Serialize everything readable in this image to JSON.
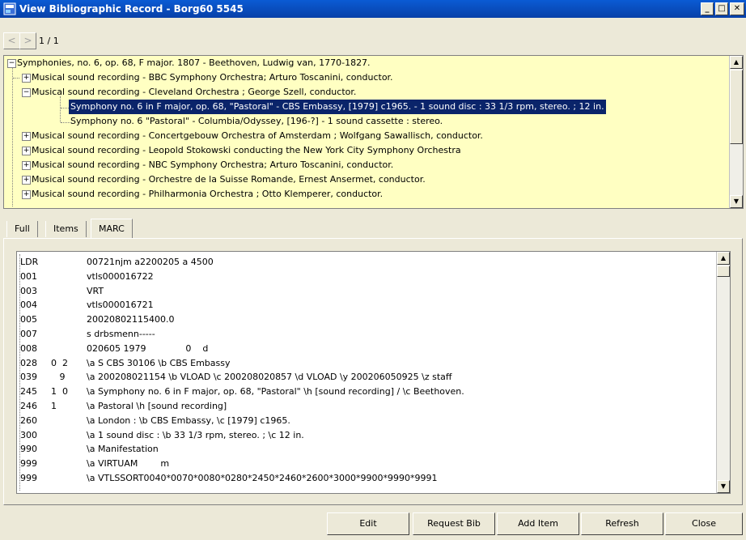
{
  "window": {
    "title": "View Bibliographic Record - Borg60 5545",
    "controls": [
      "_",
      "□",
      "✕"
    ]
  },
  "nav": {
    "prev": "<",
    "next": ">",
    "page": "1 / 1"
  },
  "tree": {
    "root": "Symphonies, no. 6, op. 68, F major. 1807 - Beethoven, Ludwig van, 1770-1827.",
    "items": [
      "Musical sound recording - BBC Symphony Orchestra; Arturo Toscanini, conductor.",
      "Musical sound recording - Cleveland Orchestra ; George Szell, conductor.",
      "Symphony no. 6 in F major, op. 68, \"Pastoral\" - CBS Embassy, [1979] c1965. - 1 sound disc : 33 1/3 rpm, stereo. ; 12 in.",
      "Symphony no. 6 \"Pastoral\" - Columbia/Odyssey, [196-?] - 1 sound cassette : stereo.",
      "Musical sound recording - Concertgebouw Orchestra of Amsterdam ; Wolfgang Sawallisch, conductor.",
      "Musical sound recording - Leopold Stokowski conducting the New York City Symphony Orchestra",
      "Musical sound recording - NBC Symphony Orchestra; Arturo Toscanini, conductor.",
      "Musical sound recording - Orchestre de la Suisse Romande, Ernest Ansermet, conductor.",
      "Musical sound recording - Philharmonia Orchestra ; Otto Klemperer, conductor."
    ]
  },
  "tabs": [
    "Full",
    "Items",
    "MARC"
  ],
  "marc": [
    {
      "tag": "LDR",
      "ind": "",
      "val": "00721njm a2200205 a 4500"
    },
    {
      "tag": "001",
      "ind": "",
      "val": "vtls000016722"
    },
    {
      "tag": "003",
      "ind": "",
      "val": "VRT"
    },
    {
      "tag": "004",
      "ind": "",
      "val": "vtls000016721"
    },
    {
      "tag": "005",
      "ind": "",
      "val": "20020802115400.0"
    },
    {
      "tag": "007",
      "ind": "",
      "val": "s drbsmenn-----"
    },
    {
      "tag": "008",
      "ind": "",
      "val": "020605 1979              0    d"
    },
    {
      "tag": "028",
      "ind": "0  2",
      "val": "\\a S CBS 30106 \\b CBS Embassy"
    },
    {
      "tag": "039",
      "ind": "   9",
      "val": "\\a 200208021154 \\b VLOAD \\c 200208020857 \\d VLOAD \\y 200206050925 \\z staff"
    },
    {
      "tag": "245",
      "ind": "1  0",
      "val": "\\a Symphony no. 6 in F major, op. 68, \"Pastoral\" \\h [sound recording] / \\c Beethoven."
    },
    {
      "tag": "246",
      "ind": "1",
      "val": "\\a Pastoral \\h [sound recording]"
    },
    {
      "tag": "260",
      "ind": "",
      "val": "\\a London : \\b CBS Embassy, \\c [1979] c1965."
    },
    {
      "tag": "300",
      "ind": "",
      "val": "\\a 1 sound disc : \\b 33 1/3 rpm, stereo. ; \\c 12 in."
    },
    {
      "tag": "990",
      "ind": "",
      "val": "\\a Manifestation"
    },
    {
      "tag": "999",
      "ind": "",
      "val": "\\a VIRTUAM        m"
    },
    {
      "tag": "999",
      "ind": "",
      "val": "\\a VTLSSORT0040*0070*0080*0280*2450*2460*2600*3000*9900*9990*9991"
    }
  ],
  "buttons": {
    "edit": "Edit",
    "request_bib": "Request Bib",
    "add_item": "Add Item",
    "refresh": "Refresh",
    "close": "Close"
  },
  "colors": {
    "titlebar": "#0a5bd4",
    "tree_bg": "#ffffc2",
    "selection": "#0a246a",
    "window_bg": "#ece9d8"
  }
}
